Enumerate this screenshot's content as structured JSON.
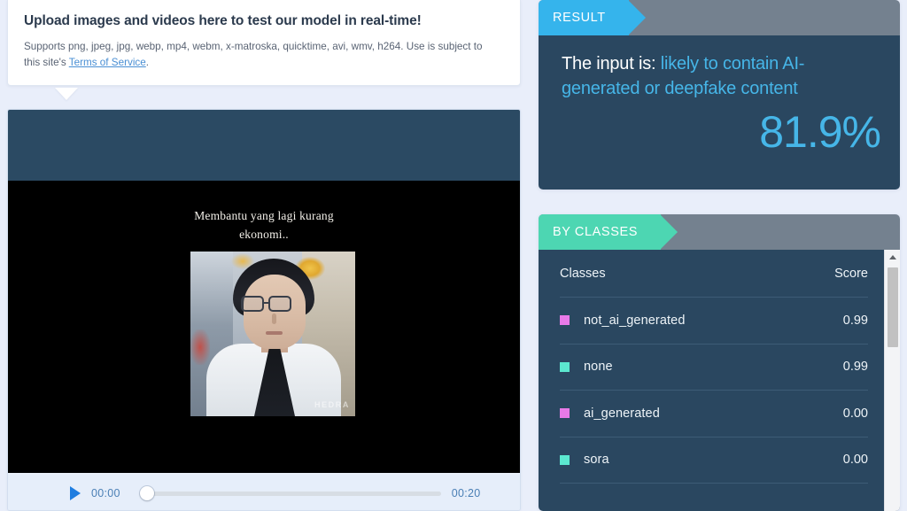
{
  "page": {
    "background": "#e9eefa"
  },
  "upload": {
    "title": "Upload images and videos here to test our model in real-time!",
    "subtitle_pre": "Supports png, jpeg, jpg, webp, mp4, webm, x-matroska, quicktime, avi, wmv, h264. Use is subject to this site's ",
    "tos_label": "Terms of Service",
    "subtitle_post": "."
  },
  "player": {
    "caption_line1": "Membantu yang lagi kurang",
    "caption_line2": "ekonomi..",
    "watermark": "HEDRA",
    "play_icon": "play-icon",
    "current_time": "00:00",
    "duration": "00:20",
    "seek_percent": 0
  },
  "result": {
    "tag": "RESULT",
    "tag_color": "#35b4ec",
    "prefix": "The input is:",
    "verdict": "likely to contain AI-generated or deepfake content",
    "verdict_color": "#46b6e8",
    "percent": "81.9%"
  },
  "classes": {
    "tag": "BY CLASSES",
    "tag_color": "#4dd6b2",
    "columns": {
      "name": "Classes",
      "score": "Score"
    },
    "rows": [
      {
        "label": "not_ai_generated",
        "score": "0.99",
        "color": "#e87ae8"
      },
      {
        "label": "none",
        "score": "0.99",
        "color": "#5ce8d0"
      },
      {
        "label": "ai_generated",
        "score": "0.00",
        "color": "#e87ae8"
      },
      {
        "label": "sora",
        "score": "0.00",
        "color": "#5ce8d0"
      }
    ],
    "scrollbar": {
      "up_icon": "chevron-up-icon",
      "thumb_position": "top"
    }
  }
}
